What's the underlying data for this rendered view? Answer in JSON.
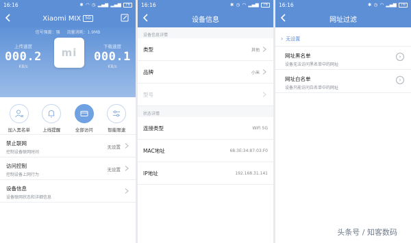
{
  "panel1": {
    "status": {
      "time": "16:16",
      "battery": "76"
    },
    "title": "Xiaomi MIX",
    "badge": "5G",
    "signal_label": "信号强度：强",
    "traffic_label": "流量消耗：1.9MB",
    "upload": {
      "label": "上传速度",
      "value": "000.2",
      "unit": "KB/s"
    },
    "download": {
      "label": "下载速度",
      "value": "000.1",
      "unit": "KB/s"
    },
    "logo_text": "mi",
    "actions": [
      {
        "label": "加入黑名单",
        "icon": "user-block-icon"
      },
      {
        "label": "上线提醒",
        "icon": "bell-icon"
      },
      {
        "label": "全部访问",
        "icon": "card-icon"
      },
      {
        "label": "智能限速",
        "icon": "sliders-icon"
      }
    ],
    "rows": [
      {
        "title": "禁止联网",
        "sub": "控制设备联网时间",
        "value": "无设置"
      },
      {
        "title": "访问控制",
        "sub": "控制设备上网行为",
        "value": "无设置"
      },
      {
        "title": "设备信息",
        "sub": "设备联网状态和详细信息",
        "value": ""
      }
    ]
  },
  "panel2": {
    "status": {
      "time": "16:16",
      "battery": "76"
    },
    "title": "设备信息",
    "section1": "设备信息详情",
    "type": {
      "label": "类型",
      "value": "其他"
    },
    "brand": {
      "label": "品牌",
      "value": "小米"
    },
    "model": {
      "label": "型号"
    },
    "section2": "状态详情",
    "conn": {
      "label": "连接类型",
      "value": "WiFi 5G"
    },
    "mac": {
      "label": "MAC地址",
      "value": "68:3E:34:87:03:F0"
    },
    "ip": {
      "label": "IP地址",
      "value": "192.168.31.141"
    }
  },
  "panel3": {
    "status": {
      "time": "16:16",
      "battery": "76"
    },
    "title": "网址过滤",
    "none": "无设置",
    "rows": [
      {
        "title": "网址黑名单",
        "sub": "设备无法访问黑名单中的网址"
      },
      {
        "title": "网址白名单",
        "sub": "设备只能访问白名单中的网址"
      }
    ]
  },
  "watermark": "头条号 / 知客数码",
  "colors": {
    "accent": "#5d8fd6",
    "active": "#6fa1e3"
  }
}
